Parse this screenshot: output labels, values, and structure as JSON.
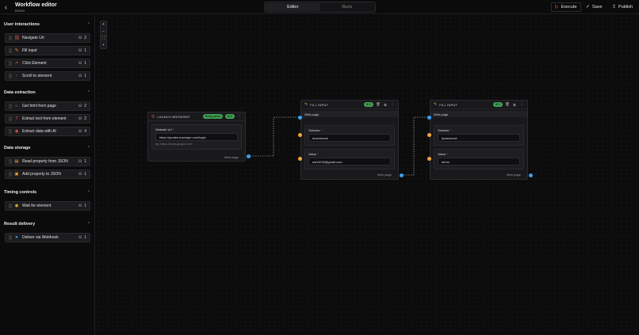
{
  "header": {
    "title": "Workflow editor",
    "subtitle": "Demo",
    "tabs": [
      "Editor",
      "Runs"
    ],
    "execute_label": "Execute",
    "save_label": "Save",
    "publish_label": "Publish"
  },
  "sidebar": {
    "sections": [
      {
        "title": "User interactions",
        "items": [
          {
            "label": "Navigate Url",
            "count": "2",
            "icon": "link-icon",
            "color": "#e05b5b"
          },
          {
            "label": "Fill input",
            "count": "1",
            "icon": "pencil-icon",
            "color": "#f0a33a"
          },
          {
            "label": "Click Element",
            "count": "1",
            "icon": "cursor-click-icon",
            "color": "#e07a3a"
          },
          {
            "label": "Scroll to element",
            "count": "1",
            "icon": "arrow-up-icon",
            "color": "#e05b5b"
          }
        ]
      },
      {
        "title": "Data extraction",
        "items": [
          {
            "label": "Get html from page",
            "count": "2",
            "icon": "code-icon",
            "color": "#e05b5b"
          },
          {
            "label": "Extract text from element",
            "count": "2",
            "icon": "text-icon",
            "color": "#e05b5b"
          },
          {
            "label": "Extract data with AI",
            "count": "4",
            "icon": "brain-icon",
            "color": "#e05b5b"
          }
        ]
      },
      {
        "title": "Data storage",
        "items": [
          {
            "label": "Read property from JSON",
            "count": "1",
            "icon": "file-json-icon",
            "color": "#f0a33a"
          },
          {
            "label": "Add property to JSON",
            "count": "1",
            "icon": "database-icon",
            "color": "#f0a33a"
          }
        ]
      },
      {
        "title": "Timing controls",
        "items": [
          {
            "label": "Wait for element",
            "count": "1",
            "icon": "eye-icon",
            "color": "#f0c03a"
          }
        ]
      },
      {
        "title": "Result delivery",
        "items": [
          {
            "label": "Deliver via Webhook",
            "count": "1",
            "icon": "send-icon",
            "color": "#3aa0f0"
          }
        ]
      }
    ]
  },
  "nodes": {
    "launch": {
      "title": "LAUNCH BROWSER",
      "badge": "Entry point",
      "count": "1",
      "field_label": "Website Url",
      "field_value": "https://quotes.toscrape.com/login",
      "hint": "eg: https://www.google.com",
      "output": "Web page"
    },
    "fill1": {
      "title": "FILL INPUT",
      "count": "1",
      "input": "Web page",
      "selector_label": "Selector",
      "selector_value": "#username",
      "value_label": "Value",
      "value_value": "ash0219@gmail.com",
      "output": "Web page"
    },
    "fill2": {
      "title": "FILL INPUT",
      "count": "1",
      "input": "Web page",
      "selector_label": "Selector",
      "selector_value": "#password",
      "value_label": "Value",
      "value_value": "demo",
      "output": "Web page"
    }
  },
  "colors": {
    "accent_green": "#3fa152",
    "handle_blue": "#3aa0f0",
    "handle_orange": "#f0a33a",
    "execute_icon": "#f08a3e"
  }
}
